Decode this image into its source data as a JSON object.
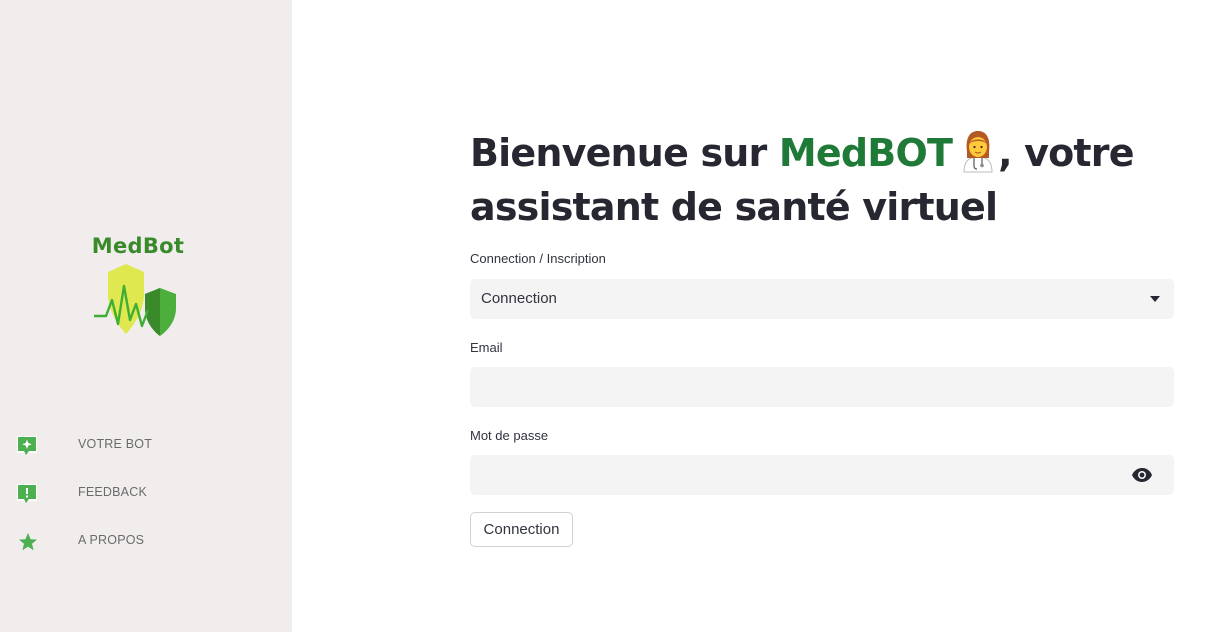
{
  "sidebar": {
    "logo_text": "MedBot",
    "nav": [
      {
        "label": "VOTRE BOT",
        "icon": "chat-sparkle-icon"
      },
      {
        "label": "FEEDBACK",
        "icon": "chat-alert-icon"
      },
      {
        "label": "A PROPOS",
        "icon": "star-icon"
      }
    ]
  },
  "main": {
    "title_prefix": "Bienvenue sur ",
    "title_brand": "MedBOT",
    "title_suffix": ", votre assistant de santé virtuel",
    "doctor_emoji_icon": "woman-health-worker-icon",
    "auth_mode": {
      "label": "Connection / Inscription",
      "value": "Connection"
    },
    "email": {
      "label": "Email",
      "value": "",
      "placeholder": ""
    },
    "password": {
      "label": "Mot de passe",
      "value": "",
      "placeholder": ""
    },
    "submit_label": "Connection"
  },
  "colors": {
    "brand_green": "#1f7a38",
    "icon_green": "#4caf50",
    "sidebar_bg": "#f0edec",
    "input_bg": "#f4f4f4"
  }
}
